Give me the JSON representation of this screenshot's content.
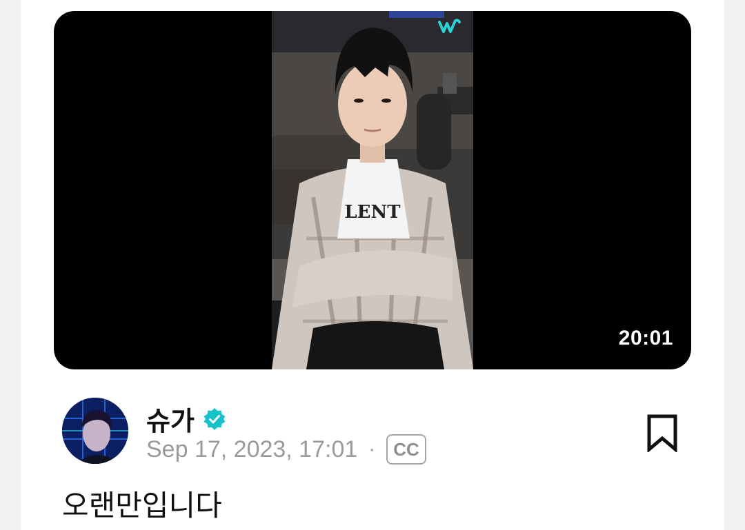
{
  "post": {
    "video": {
      "duration": "20:01",
      "brand_logo_icon": "weverse-logo-icon",
      "brand_color": "#2ad3d3"
    },
    "author": {
      "name": "슈가",
      "verified_icon": "verified-badge-icon",
      "verified_color": "#16c1c9",
      "avatar_icon": "avatar-photo"
    },
    "date": "Sep 17, 2023, 17:01",
    "separator": "·",
    "cc_label": "CC",
    "bookmark_icon": "bookmark-icon",
    "caption": "오랜만입니다"
  }
}
